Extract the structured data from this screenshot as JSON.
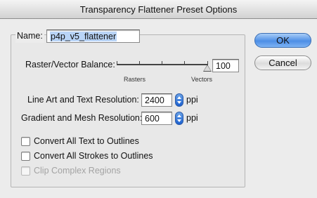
{
  "window": {
    "title": "Transparency Flattener Preset Options"
  },
  "name": {
    "label": "Name:",
    "value": "p4p_v5_flattener"
  },
  "raster_vector": {
    "label": "Raster/Vector Balance:",
    "value": "100",
    "min_label": "Rasters",
    "max_label": "Vectors",
    "level": 100
  },
  "line_art": {
    "label": "Line Art and Text Resolution:",
    "value": "2400",
    "unit": "ppi"
  },
  "gradient_mesh": {
    "label": "Gradient and Mesh Resolution:",
    "value": "600",
    "unit": "ppi"
  },
  "options": {
    "convert_text": {
      "label": "Convert All Text to Outlines",
      "checked": false
    },
    "convert_strokes": {
      "label": "Convert All Strokes to Outlines",
      "checked": false
    },
    "clip_regions": {
      "label": "Clip Complex Regions",
      "checked": false,
      "disabled": true
    }
  },
  "buttons": {
    "ok": "OK",
    "cancel": "Cancel"
  }
}
